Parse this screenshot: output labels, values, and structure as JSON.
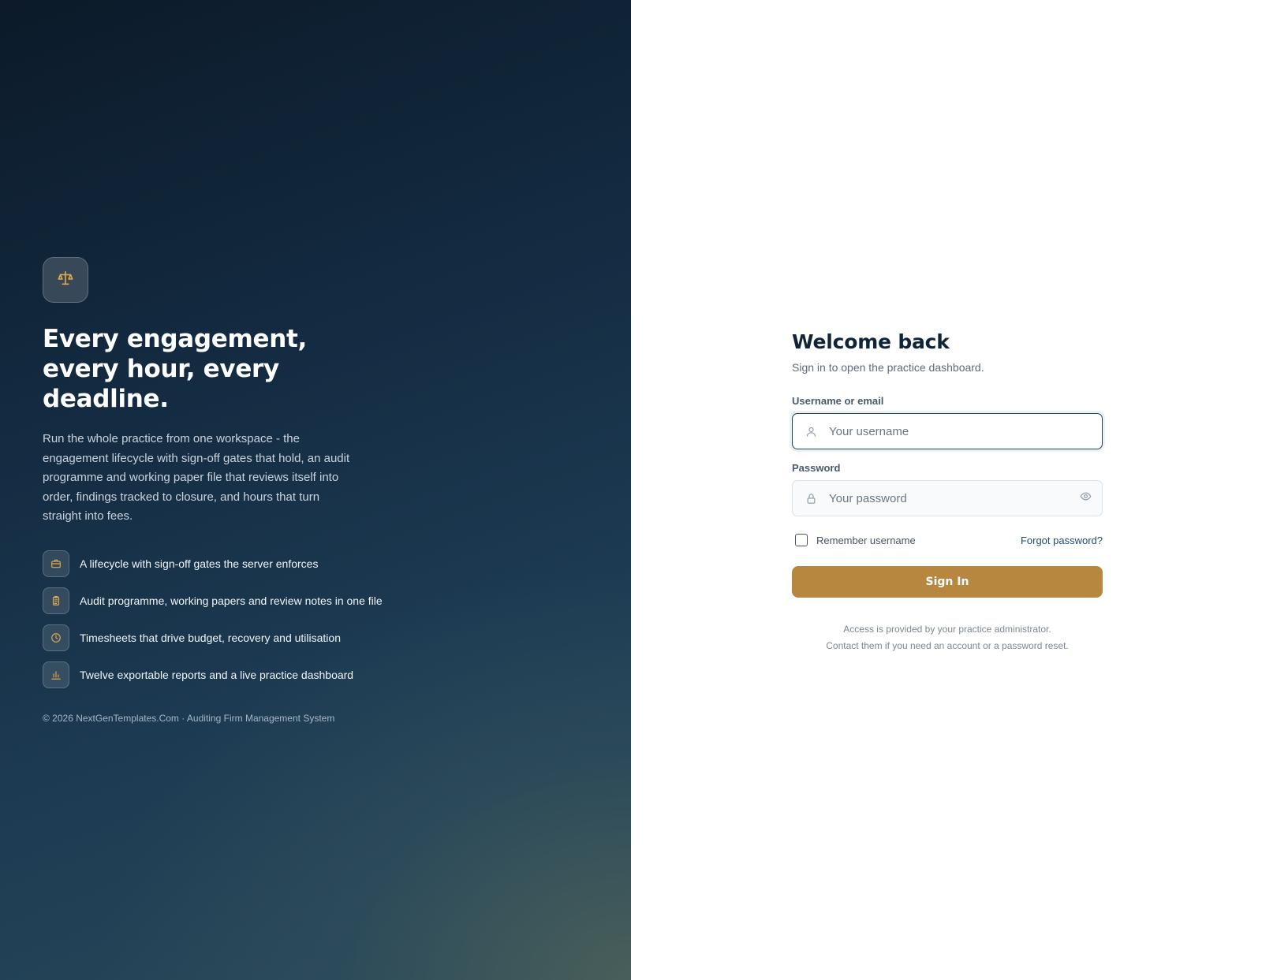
{
  "hero": {
    "brand_icon": "scale-icon",
    "headline": "Every engagement, every hour, every deadline.",
    "intro": "Run the whole practice from one workspace - the engagement lifecycle with sign-off gates that hold, an audit programme and working paper file that reviews itself into order, findings tracked to closure, and hours that turn straight into fees.",
    "features": [
      {
        "icon": "briefcase-icon",
        "text": "A lifecycle with sign-off gates the server enforces"
      },
      {
        "icon": "clipboard-icon",
        "text": "Audit programme, working papers and review notes in one file"
      },
      {
        "icon": "clock-icon",
        "text": "Timesheets that drive budget, recovery and utilisation"
      },
      {
        "icon": "bar-chart-icon",
        "text": "Twelve exportable reports and a live practice dashboard"
      }
    ],
    "copyright": "© 2026 NextGenTemplates.Com · Auditing Firm Management System"
  },
  "login": {
    "title": "Welcome back",
    "subtitle": "Sign in to open the practice dashboard.",
    "username_label": "Username or email",
    "username_placeholder": "Your username",
    "username_value": "",
    "password_label": "Password",
    "password_placeholder": "Your password",
    "password_value": "",
    "remember_label": "Remember username",
    "remember_checked": false,
    "forgot_label": "Forgot password?",
    "submit_label": "Sign In",
    "notice_line1": "Access is provided by your practice administrator.",
    "notice_line2": "Contact them if you need an account or a password reset."
  },
  "colors": {
    "accent_gold": "#b8873f",
    "icon_gold": "#d9a24a",
    "navy": "#0f2438",
    "focus_border": "#1d4563"
  }
}
